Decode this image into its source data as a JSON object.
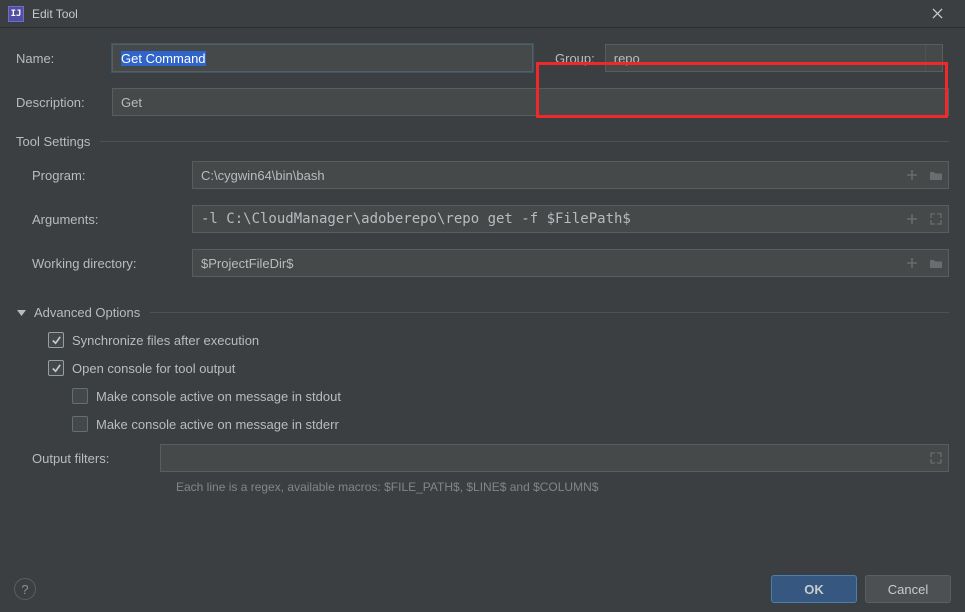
{
  "window": {
    "title": "Edit Tool"
  },
  "form": {
    "name_label": "Name:",
    "name_value": "Get Command",
    "group_label": "Group:",
    "group_value": "repo",
    "description_label": "Description:",
    "description_value": "Get"
  },
  "tool_settings": {
    "section_title": "Tool Settings",
    "program_label": "Program:",
    "program_value": "C:\\cygwin64\\bin\\bash",
    "arguments_label": "Arguments:",
    "arguments_value": "-l C:\\CloudManager\\adoberepo\\repo get -f $FilePath$",
    "workdir_label": "Working directory:",
    "workdir_value": "$ProjectFileDir$"
  },
  "advanced": {
    "section_title": "Advanced Options",
    "sync_label": "Synchronize files after execution",
    "sync_checked": true,
    "open_console_label": "Open console for tool output",
    "open_console_checked": true,
    "stdout_label": "Make console active on message in stdout",
    "stdout_checked": false,
    "stderr_label": "Make console active on message in stderr",
    "stderr_checked": false,
    "output_filters_label": "Output filters:",
    "output_filters_value": "",
    "hint": "Each line is a regex, available macros: $FILE_PATH$, $LINE$ and $COLUMN$"
  },
  "buttons": {
    "ok": "OK",
    "cancel": "Cancel"
  },
  "icons": {
    "help": "?"
  }
}
